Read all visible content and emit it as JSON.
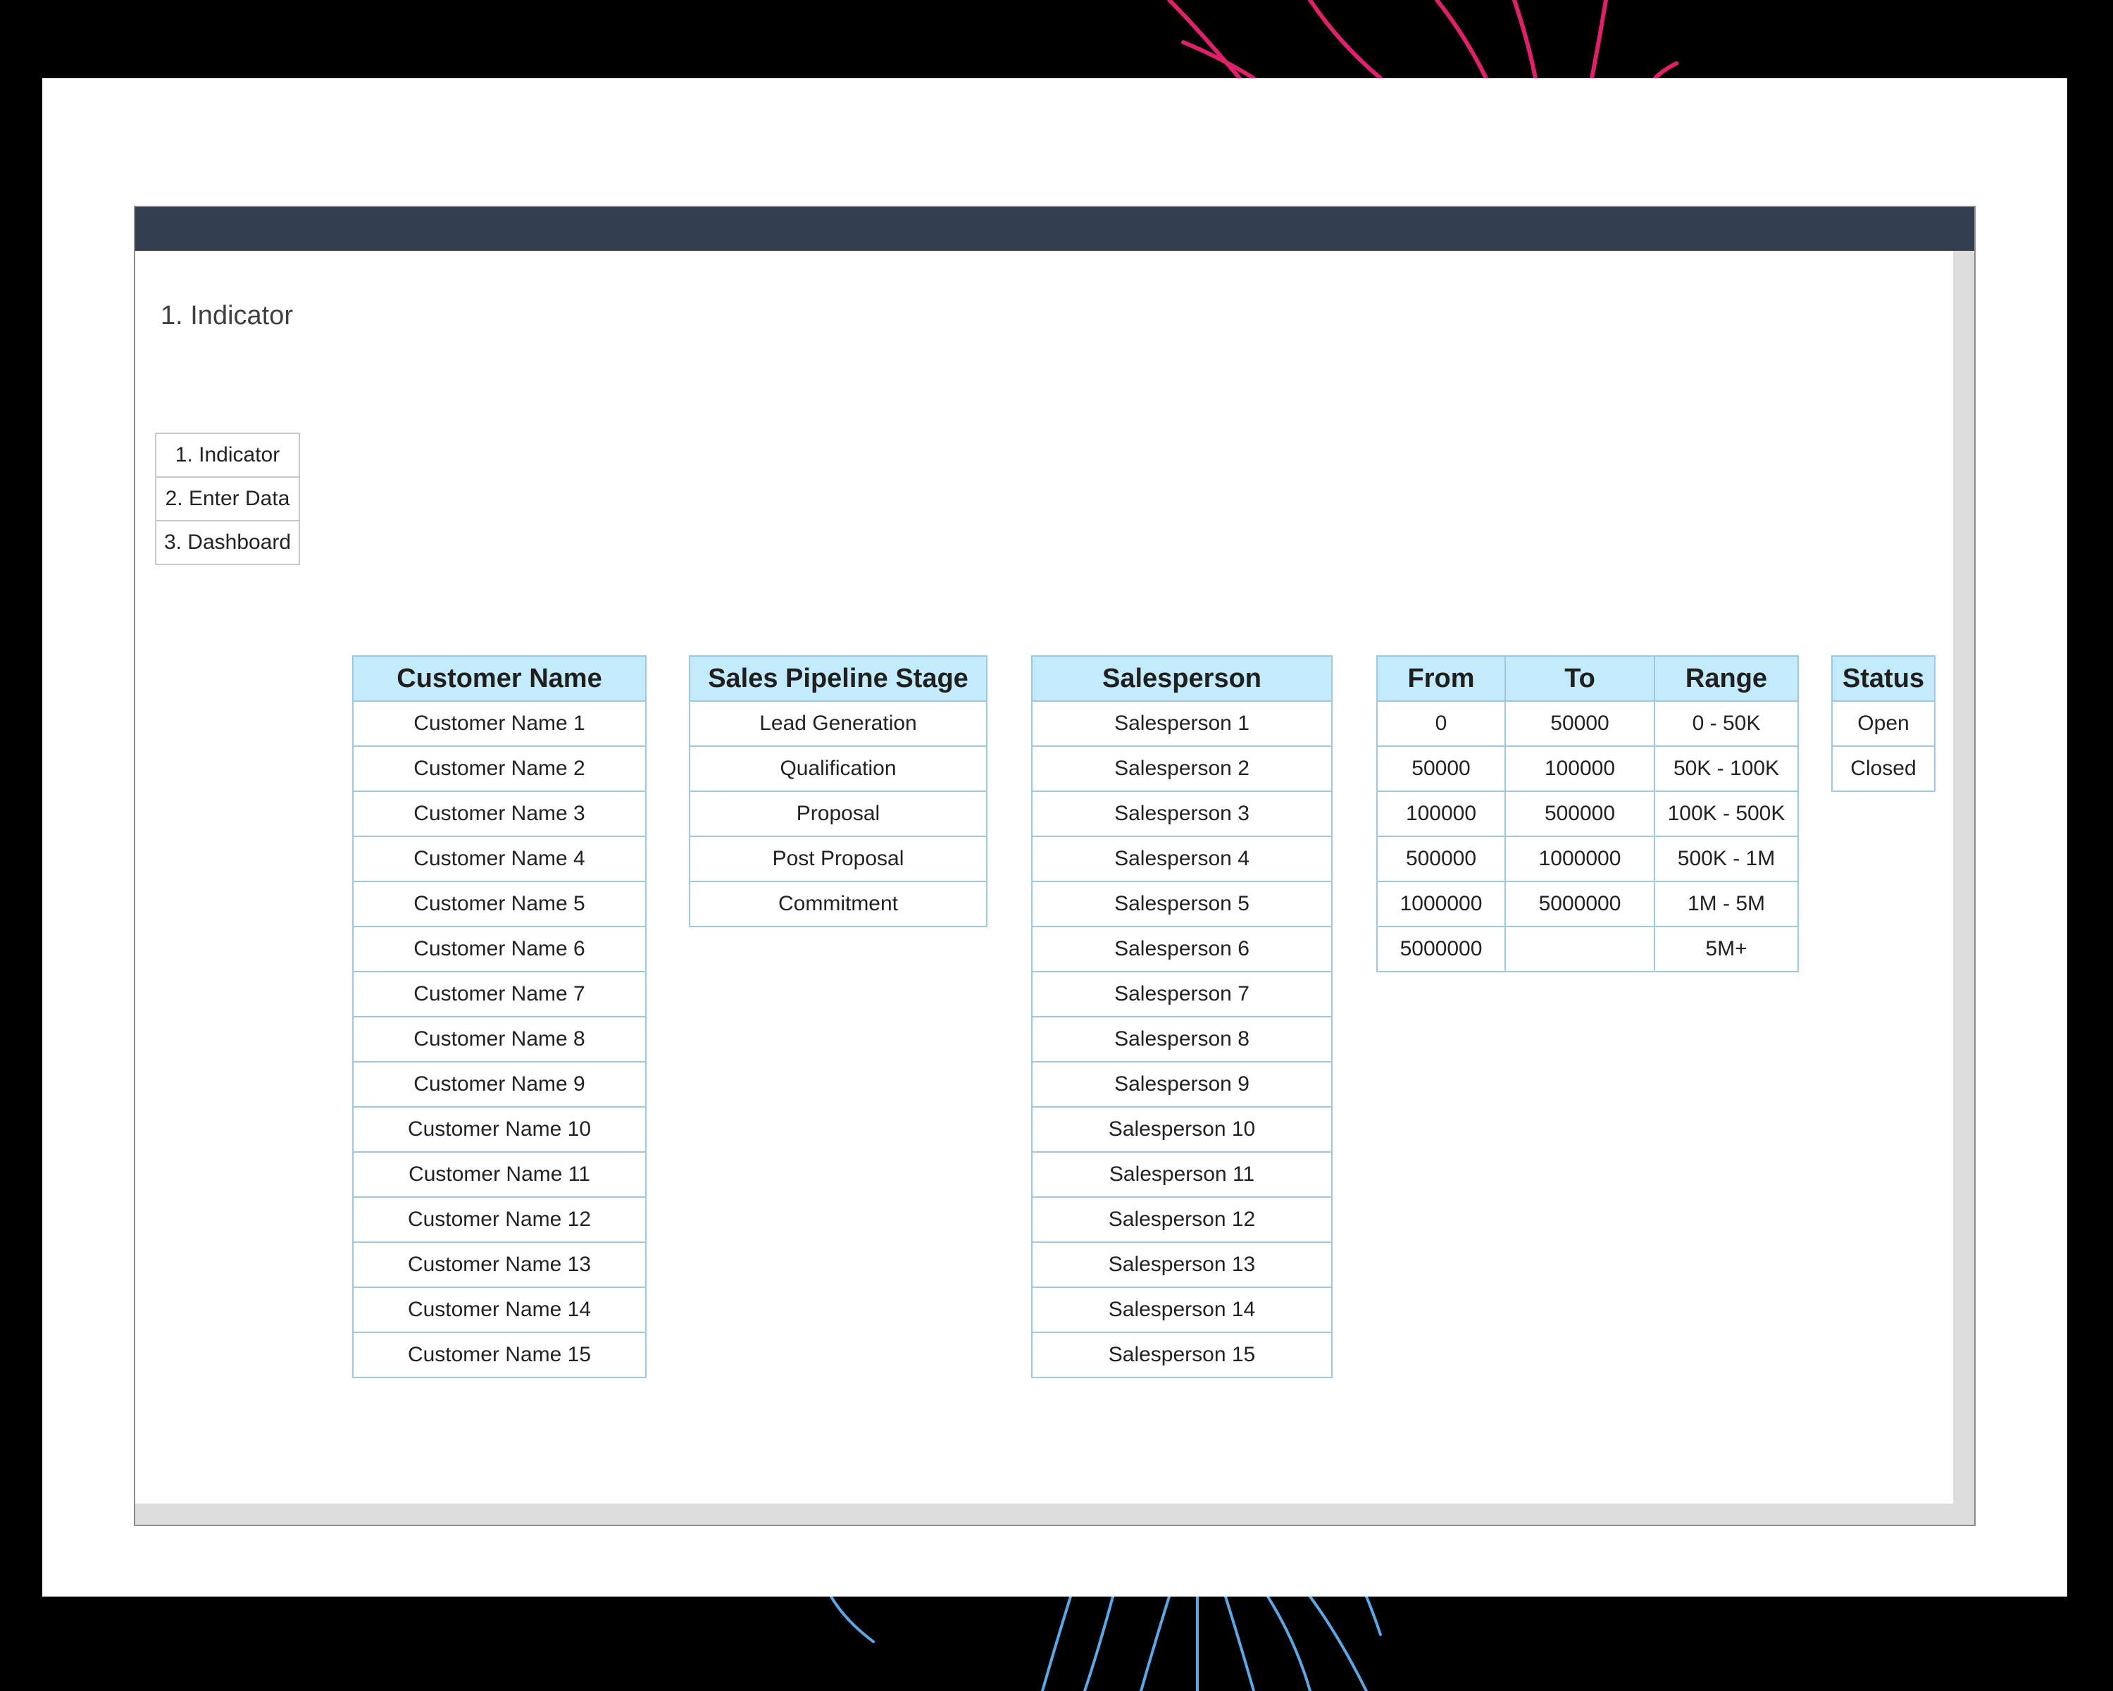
{
  "colors": {
    "header_bar": "#333f4f",
    "table_header": "#c4ebfb",
    "table_border": "#9cc9e3",
    "backdrop": "#000000"
  },
  "sheet": {
    "title": "1. Indicator"
  },
  "nav": {
    "items": [
      {
        "label": "1. Indicator"
      },
      {
        "label": "2. Enter Data"
      },
      {
        "label": "3. Dashboard"
      }
    ]
  },
  "customers": {
    "header": "Customer Name",
    "items": [
      "Customer Name 1",
      "Customer Name 2",
      "Customer Name 3",
      "Customer Name 4",
      "Customer Name 5",
      "Customer Name 6",
      "Customer Name 7",
      "Customer Name 8",
      "Customer Name 9",
      "Customer Name 10",
      "Customer Name 11",
      "Customer Name 12",
      "Customer Name 13",
      "Customer Name 14",
      "Customer Name 15"
    ]
  },
  "stages": {
    "header": "Sales Pipeline Stage",
    "items": [
      "Lead Generation",
      "Qualification",
      "Proposal",
      "Post Proposal",
      "Commitment"
    ]
  },
  "salespersons": {
    "header": "Salesperson",
    "items": [
      "Salesperson 1",
      "Salesperson 2",
      "Salesperson 3",
      "Salesperson 4",
      "Salesperson 5",
      "Salesperson 6",
      "Salesperson 7",
      "Salesperson 8",
      "Salesperson 9",
      "Salesperson 10",
      "Salesperson 11",
      "Salesperson 12",
      "Salesperson 13",
      "Salesperson 14",
      "Salesperson 15"
    ]
  },
  "ranges": {
    "headers": [
      "From",
      "To",
      "Range"
    ],
    "rows": [
      [
        "0",
        "50000",
        "0 - 50K"
      ],
      [
        "50000",
        "100000",
        "50K - 100K"
      ],
      [
        "100000",
        "500000",
        "100K - 500K"
      ],
      [
        "500000",
        "1000000",
        "500K - 1M"
      ],
      [
        "1000000",
        "5000000",
        "1M - 5M"
      ],
      [
        "5000000",
        "",
        "5M+"
      ]
    ]
  },
  "status": {
    "header": "Status",
    "items": [
      "Open",
      "Closed"
    ]
  }
}
